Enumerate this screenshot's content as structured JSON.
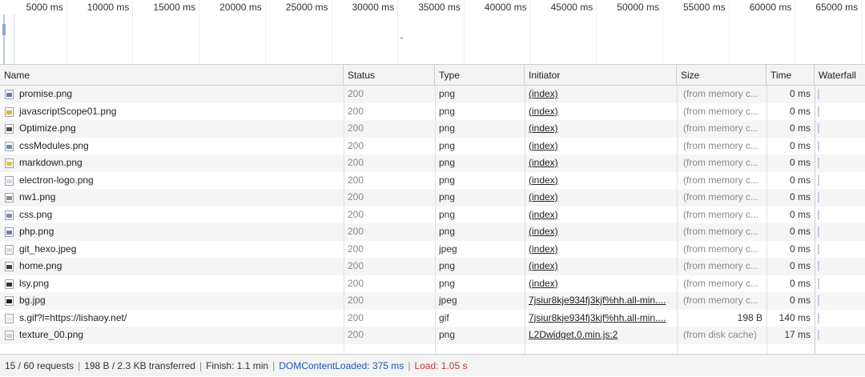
{
  "overview": {
    "ticks": [
      "5000 ms",
      "10000 ms",
      "15000 ms",
      "20000 ms",
      "25000 ms",
      "30000 ms",
      "35000 ms",
      "40000 ms",
      "45000 ms",
      "50000 ms",
      "55000 ms",
      "60000 ms",
      "65000 ms"
    ]
  },
  "columns": {
    "name": "Name",
    "status": "Status",
    "type": "Type",
    "initiator": "Initiator",
    "size": "Size",
    "time": "Time",
    "waterfall": "Waterfall"
  },
  "rows": [
    {
      "name": "promise.png",
      "status": "200",
      "type": "png",
      "initiator": "(index)",
      "size": "(from memory c...",
      "time": "0 ms",
      "icon": "image-file-icon",
      "icon_color": "#5e7fa8"
    },
    {
      "name": "javascriptScope01.png",
      "status": "200",
      "type": "png",
      "initiator": "(index)",
      "size": "(from memory c...",
      "time": "0 ms",
      "icon": "image-file-icon",
      "icon_color": "#e2b23c"
    },
    {
      "name": "Optimize.png",
      "status": "200",
      "type": "png",
      "initiator": "(index)",
      "size": "(from memory c...",
      "time": "0 ms",
      "icon": "image-file-icon",
      "icon_color": "#4a4f57"
    },
    {
      "name": "cssModules.png",
      "status": "200",
      "type": "png",
      "initiator": "(index)",
      "size": "(from memory c...",
      "time": "0 ms",
      "icon": "image-file-icon",
      "icon_color": "#6b8fa8"
    },
    {
      "name": "markdown.png",
      "status": "200",
      "type": "png",
      "initiator": "(index)",
      "size": "(from memory c...",
      "time": "0 ms",
      "icon": "image-file-icon",
      "icon_color": "#e8c13a"
    },
    {
      "name": "electron-logo.png",
      "status": "200",
      "type": "png",
      "initiator": "(index)",
      "size": "(from memory c...",
      "time": "0 ms",
      "icon": "image-file-icon",
      "icon_color": "#cfd8e3"
    },
    {
      "name": "nw1.png",
      "status": "200",
      "type": "png",
      "initiator": "(index)",
      "size": "(from memory c...",
      "time": "0 ms",
      "icon": "image-file-icon",
      "icon_color": "#8a8f96"
    },
    {
      "name": "css.png",
      "status": "200",
      "type": "png",
      "initiator": "(index)",
      "size": "(from memory c...",
      "time": "0 ms",
      "icon": "image-file-icon",
      "icon_color": "#7e8ea3"
    },
    {
      "name": "php.png",
      "status": "200",
      "type": "png",
      "initiator": "(index)",
      "size": "(from memory c...",
      "time": "0 ms",
      "icon": "image-file-icon",
      "icon_color": "#6d7fb5"
    },
    {
      "name": "git_hexo.jpeg",
      "status": "200",
      "type": "jpeg",
      "initiator": "(index)",
      "size": "(from memory c...",
      "time": "0 ms",
      "icon": "image-file-icon",
      "icon_color": "#d7dbe0"
    },
    {
      "name": "home.png",
      "status": "200",
      "type": "png",
      "initiator": "(index)",
      "size": "(from memory c...",
      "time": "0 ms",
      "icon": "image-file-icon",
      "icon_color": "#3d4148"
    },
    {
      "name": "lsy.png",
      "status": "200",
      "type": "png",
      "initiator": "(index)",
      "size": "(from memory c...",
      "time": "0 ms",
      "icon": "image-file-icon",
      "icon_color": "#2f3136"
    },
    {
      "name": "bg.jpg",
      "status": "200",
      "type": "jpeg",
      "initiator": "7jsiur8kje934fj3kjf%hh.all-min....",
      "size": "(from memory c...",
      "time": "0 ms",
      "icon": "image-file-icon",
      "icon_color": "#1b1b1b"
    },
    {
      "name": "s.gif?l=https://lishaoy.net/",
      "status": "200",
      "type": "gif",
      "initiator": "7jsiur8kje934fj3kjf%hh.all-min....",
      "size": "198 B",
      "time": "140 ms",
      "icon": "file-icon",
      "icon_color": "#e6e9ee",
      "size_numeric": true
    },
    {
      "name": "texture_00.png",
      "status": "200",
      "type": "png",
      "initiator": "L2Dwidget.0.min.js:2",
      "size": "(from disk cache)",
      "time": "17 ms",
      "icon": "image-file-icon",
      "icon_color": "#c9ced6"
    }
  ],
  "status_bar": {
    "requests": "15 / 60 requests",
    "transferred": "198 B / 2.3 KB transferred",
    "finish": "Finish: 1.1 min",
    "dom_content_loaded": "DOMContentLoaded: 375 ms",
    "load": "Load: 1.05 s"
  }
}
